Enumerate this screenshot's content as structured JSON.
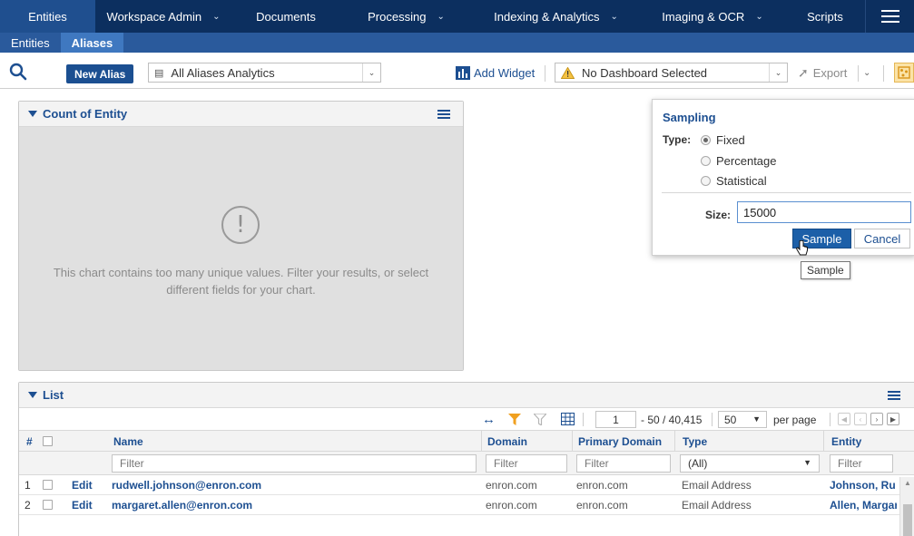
{
  "nav": {
    "tabs": [
      {
        "label": "Entities",
        "dropdown": false
      },
      {
        "label": "Workspace Admin",
        "dropdown": true
      },
      {
        "label": "Documents",
        "dropdown": false
      },
      {
        "label": "Processing",
        "dropdown": true
      },
      {
        "label": "Indexing & Analytics",
        "dropdown": true
      },
      {
        "label": "Imaging & OCR",
        "dropdown": true
      },
      {
        "label": "Scripts",
        "dropdown": false
      }
    ],
    "subtabs": [
      "Entities",
      "Aliases"
    ]
  },
  "toolbar": {
    "new_alias": "New Alias",
    "view_select": "All Aliases Analytics",
    "add_widget": "Add Widget",
    "dashboard_select": "No Dashboard Selected",
    "export": "Export"
  },
  "chart_panel": {
    "title": "Count of Entity",
    "message": "This chart contains too many unique values. Filter your results, or select different fields for your chart."
  },
  "sampling": {
    "title": "Sampling",
    "type_label": "Type:",
    "options": [
      "Fixed",
      "Percentage",
      "Statistical"
    ],
    "selected": "Fixed",
    "size_label": "Size:",
    "size_value": "15000",
    "sample_button": "Sample",
    "cancel_button": "Cancel",
    "tooltip": "Sample"
  },
  "list": {
    "title": "List",
    "page_value": "1",
    "range_text": "- 50 / 40,415",
    "per_page_value": "50",
    "per_page_label": "per page",
    "columns": {
      "num": "#",
      "name": "Name",
      "domain": "Domain",
      "primary_domain": "Primary Domain",
      "type": "Type",
      "entity": "Entity"
    },
    "filter_placeholder": "Filter",
    "type_filter_value": "(All)",
    "rows": [
      {
        "num": "1",
        "edit": "Edit",
        "name": "rudwell.johnson@enron.com",
        "domain": "enron.com",
        "primary_domain": "enron.com",
        "type": "Email Address",
        "entity": "Johnson, Ru"
      },
      {
        "num": "2",
        "edit": "Edit",
        "name": "margaret.allen@enron.com",
        "domain": "enron.com",
        "primary_domain": "enron.com",
        "type": "Email Address",
        "entity": "Allen, Margar"
      }
    ]
  }
}
